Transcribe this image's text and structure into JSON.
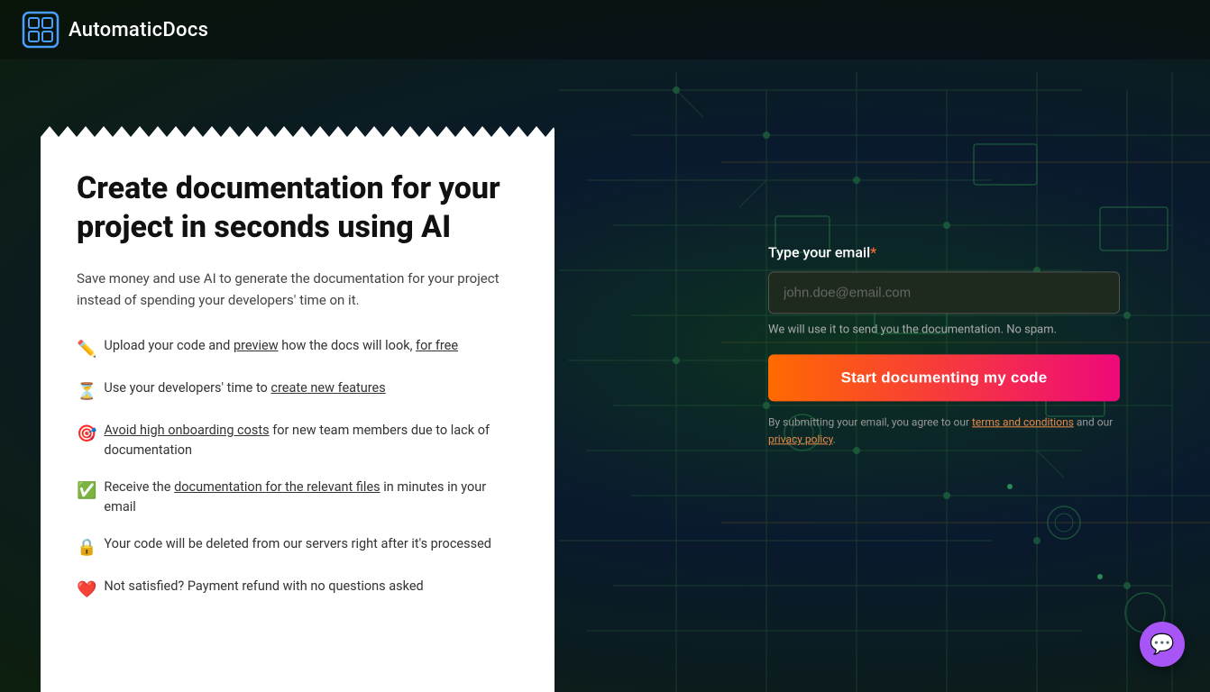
{
  "brand": {
    "logo_alt": "AutomaticDocs Logo",
    "name": "AutomaticDocs"
  },
  "card": {
    "title": "Create documentation for your project in seconds using AI",
    "subtitle": "Save money and use AI to generate the documentation for your project instead of spending your developers' time on it.",
    "features": [
      {
        "icon": "✏️",
        "text_before": "Upload your code and ",
        "link1_text": "preview",
        "text_middle": " how the docs will look, ",
        "link2_text": "for free",
        "text_after": ""
      },
      {
        "icon": "⏳",
        "text_before": "Use your developers' time to ",
        "link1_text": "create new features",
        "text_after": ""
      },
      {
        "icon": "🎯",
        "text_before": "",
        "link1_text": "Avoid high onboarding costs",
        "text_after": " for new team members due to lack of documentation"
      },
      {
        "icon": "✅",
        "text_before": "Receive the ",
        "link1_text": "documentation for the relevant files",
        "text_after": " in minutes in your email"
      },
      {
        "icon": "🔒",
        "text_before": "Your code will be deleted from our servers right after it's processed",
        "link1_text": "",
        "text_after": ""
      },
      {
        "icon": "❤️",
        "text_before": "Not satisfied? Payment refund with no questions asked",
        "link1_text": "",
        "text_after": ""
      }
    ]
  },
  "form": {
    "email_label": "Type your email",
    "required_marker": "*",
    "email_placeholder": "john.doe@email.com",
    "hint": "We will use it to send you the documentation. No spam.",
    "cta_label": "Start documenting my code",
    "terms_prefix": "By submitting your email, you agree to our ",
    "terms_link": "terms and conditions",
    "terms_middle": " and our ",
    "privacy_link": "privacy policy",
    "terms_suffix": "."
  },
  "chat": {
    "icon": "💬"
  }
}
